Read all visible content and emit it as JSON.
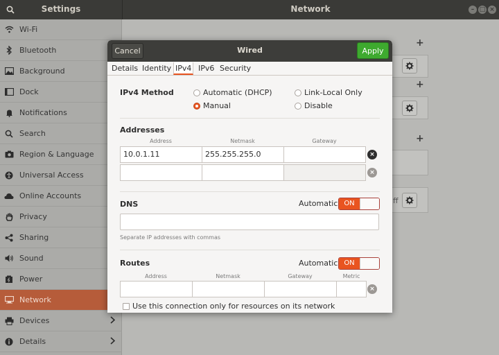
{
  "app": {
    "left_title": "Settings",
    "window_title": "Network"
  },
  "sidebar": {
    "items": [
      {
        "label": "Wi-Fi",
        "icon": "wifi-icon"
      },
      {
        "label": "Bluetooth",
        "icon": "bluetooth-icon"
      },
      {
        "label": "Background",
        "icon": "background-icon"
      },
      {
        "label": "Dock",
        "icon": "dock-icon"
      },
      {
        "label": "Notifications",
        "icon": "bell-icon"
      },
      {
        "label": "Search",
        "icon": "search-icon"
      },
      {
        "label": "Region & Language",
        "icon": "camera-icon"
      },
      {
        "label": "Universal Access",
        "icon": "universal-access-icon"
      },
      {
        "label": "Online Accounts",
        "icon": "cloud-icon"
      },
      {
        "label": "Privacy",
        "icon": "hand-icon"
      },
      {
        "label": "Sharing",
        "icon": "share-icon"
      },
      {
        "label": "Sound",
        "icon": "speaker-icon"
      },
      {
        "label": "Power",
        "icon": "power-icon"
      },
      {
        "label": "Network",
        "icon": "network-icon",
        "active": true
      },
      {
        "label": "Devices",
        "icon": "printer-icon",
        "chevron": true
      },
      {
        "label": "Details",
        "icon": "info-icon",
        "chevron": true
      }
    ]
  },
  "background": {
    "vpn_partial_text": "ff"
  },
  "dialog": {
    "title": "Wired",
    "cancel_label": "Cancel",
    "apply_label": "Apply",
    "tabs": [
      "Details",
      "Identity",
      "IPv4",
      "IPv6",
      "Security"
    ],
    "active_tab": "IPv4",
    "ipv4_method": {
      "label": "IPv4 Method",
      "options": [
        "Automatic (DHCP)",
        "Link-Local Only",
        "Manual",
        "Disable"
      ],
      "selected": "Manual"
    },
    "addresses": {
      "label": "Addresses",
      "columns": [
        "Address",
        "Netmask",
        "Gateway"
      ],
      "rows": [
        {
          "address": "10.0.1.11",
          "netmask": "255.255.255.0",
          "gateway": ""
        },
        {
          "address": "",
          "netmask": "",
          "gateway": ""
        }
      ]
    },
    "dns": {
      "label": "DNS",
      "automatic_label": "Automatic",
      "switch_label": "ON",
      "value": "",
      "hint": "Separate IP addresses with commas"
    },
    "routes": {
      "label": "Routes",
      "automatic_label": "Automatic",
      "switch_label": "ON",
      "columns": [
        "Address",
        "Netmask",
        "Gateway",
        "Metric"
      ]
    },
    "only_resources_label": "Use this connection only for resources on its network"
  },
  "colors": {
    "accent": "#e95420",
    "apply_green": "#3eaa2f",
    "active_sidebar": "#b65c3a"
  }
}
